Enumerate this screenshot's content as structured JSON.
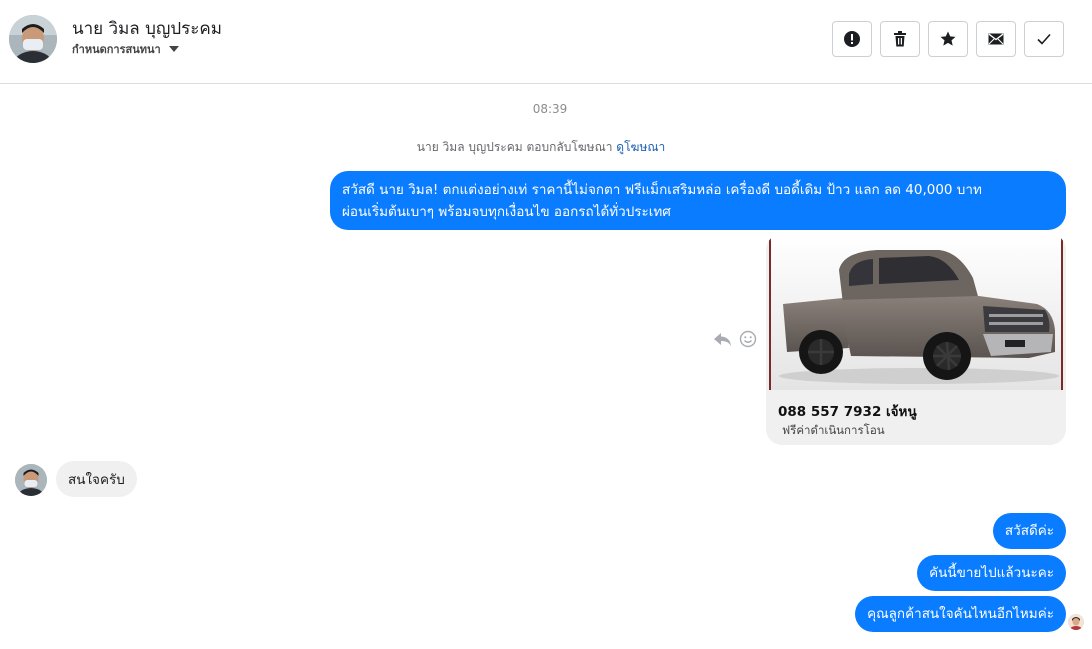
{
  "header": {
    "contact_name": "นาย วิมล บุญประคม",
    "subtitle": "กำหนดการสนทนา",
    "actions": [
      {
        "icon": "alert-icon",
        "name": "report-button"
      },
      {
        "icon": "trash-icon",
        "name": "delete-button"
      },
      {
        "icon": "star-icon",
        "name": "star-button"
      },
      {
        "icon": "mail-icon",
        "name": "mark-unread-button"
      },
      {
        "icon": "check-icon",
        "name": "mark-done-button"
      }
    ]
  },
  "thread": {
    "timestamp": "08:39",
    "system_text": "นาย วิมล บุญประคม ตอบกลับโฆษณา",
    "system_link": "ดูโฆษณา",
    "messages_out": {
      "ad_line1": "สวัสดี นาย วิมล! ตกแต่งอย่างเท่ ราคานี้ไม่จกตา ฟรีแม็กเสริมหล่อ เครื่องดี บอดี้เดิม ป้าว แลก ลด 40,000 บาท",
      "ad_line2": "ผ่อนเริ่มต้นเบาๆ พร้อมจบทุกเงื่อนไข ออกรถได้ทั่วประเทศ",
      "reply1": "สวัสดีค่ะ",
      "reply2": "คันนี้ขายไปแล้วนะคะ",
      "reply3": "คุณลูกค้าสนใจคันไหนอีกไหมค่ะ"
    },
    "ad_card": {
      "title": "088 557 7932 เจ้หนู",
      "subtitle": "ฟรีค่าดำเนินการโอน",
      "image": "silver-pickup-truck-photo"
    },
    "message_in": "สนใจครับ",
    "hover_icons": [
      "reply-icon",
      "emoji-icon"
    ]
  },
  "colors": {
    "accent": "#0a7cff",
    "incoming_bubble": "#f0f0f0"
  }
}
